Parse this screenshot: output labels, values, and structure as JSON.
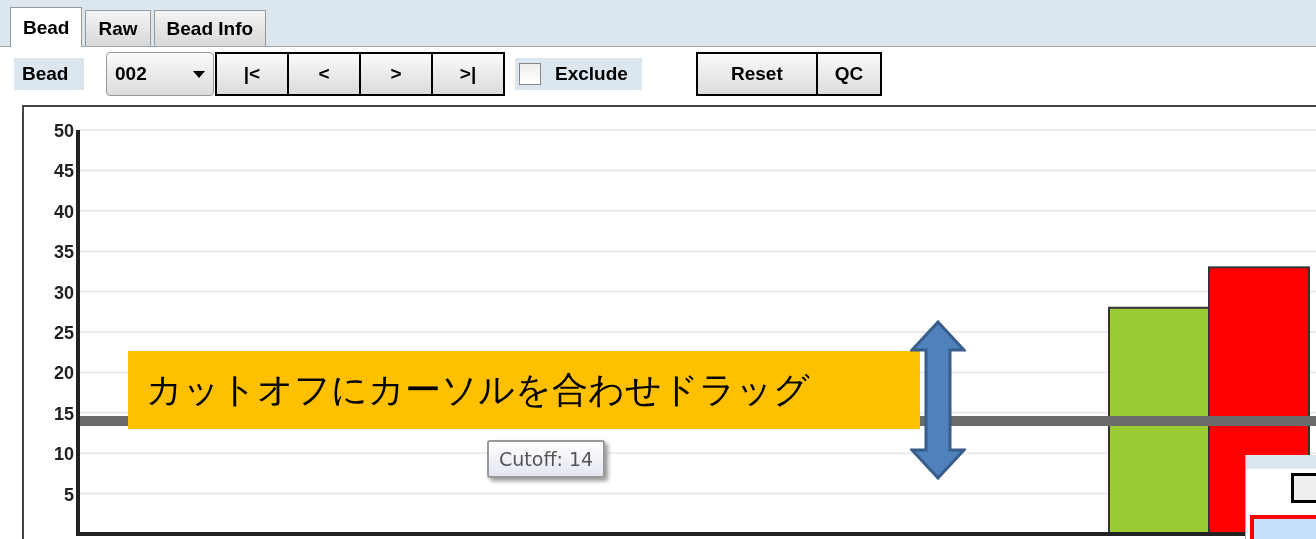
{
  "tabs": [
    {
      "label": "Bead",
      "selected": true
    },
    {
      "label": "Raw",
      "selected": false
    },
    {
      "label": "Bead Info",
      "selected": false
    }
  ],
  "toolbar": {
    "bead_label": "Bead",
    "bead_select": {
      "value": "002"
    },
    "nav_buttons": [
      "|<",
      "<",
      ">",
      ">|"
    ],
    "exclude": {
      "label": "Exclude",
      "checked": false
    },
    "buttons": [
      "Reset",
      "QC"
    ]
  },
  "chart": {
    "chart_data": {
      "type": "bar",
      "series": [
        {
          "color": "#99cc33",
          "values": [
            28
          ]
        },
        {
          "color": "#ff0000",
          "values": [
            33
          ]
        }
      ],
      "ylim": [
        0,
        50
      ],
      "yticks": [
        5,
        10,
        15,
        20,
        25,
        30,
        35,
        40,
        45,
        50
      ],
      "grid": true,
      "ref_lines": [
        {
          "axis": "y",
          "value": 14,
          "label": "Cutoff: 14"
        }
      ]
    }
  },
  "callout": {
    "text": "カットオフにカーソルを合わせドラッグ"
  }
}
